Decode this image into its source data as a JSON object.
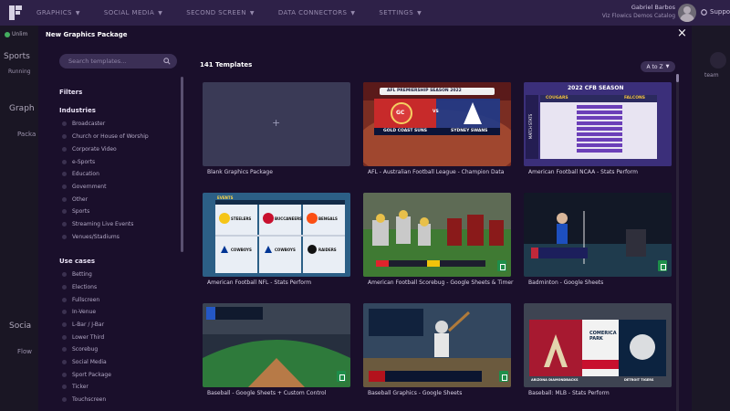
{
  "app": {
    "nav": [
      "GRAPHICS",
      "SOCIAL MEDIA",
      "SECOND SCREEN",
      "DATA CONNECTORS",
      "SETTINGS"
    ],
    "user": {
      "name": "Gabriel Barbos",
      "org": "Viz Flowics Demos Catalog"
    },
    "support_label": "Support",
    "bg": {
      "status": "Unlim",
      "sports": "Sports",
      "running": "Running",
      "graph": "Graph",
      "packa": "Packa",
      "socia": "Socia",
      "flow": "Flow",
      "team": "team"
    }
  },
  "modal": {
    "title": "New Graphics Package",
    "close": "×",
    "search_placeholder": "Search templates...",
    "filters_label": "Filters",
    "industries_label": "Industries",
    "industries": [
      "Broadcaster",
      "Church or House of Worship",
      "Corporate Video",
      "e-Sports",
      "Education",
      "Government",
      "Other",
      "Sports",
      "Streaming Live Events",
      "Venues/Stadiums"
    ],
    "use_cases_label": "Use cases",
    "use_cases": [
      "Betting",
      "Elections",
      "Fullscreen",
      "In-Venue",
      "L-Bar / J-Bar",
      "Lower Third",
      "Scorebug",
      "Social Media",
      "Sport Package",
      "Ticker",
      "Touchscreen"
    ],
    "template_count": "141 Templates",
    "sort_label": "A to Z",
    "templates": [
      {
        "label": "Blank Graphics Package",
        "blank": true,
        "plus": "+"
      },
      {
        "label": "AFL - Australian Football League - Champion Data",
        "banner": "AFL PREMIERSHIP SEASON 2022",
        "home": "GOLD COAST SUNS",
        "away": "SYDNEY SWANS",
        "home_abbr": "GC",
        "vs": "VS"
      },
      {
        "label": "American Football NCAA - Stats Perform",
        "banner": "2022 CFB SEASON",
        "home": "COUGARS",
        "away": "FALCONS",
        "side": "MATCH STATS"
      },
      {
        "label": "American Football NFL - Stats Perform",
        "events": "EVENTS",
        "teams": [
          "STEELERS",
          "BUCCANEERS",
          "BENGALS",
          "COWBOYS",
          "COWBOYS",
          "RAIDERS"
        ]
      },
      {
        "label": "American Football Scorebug - Google Sheets & Timer"
      },
      {
        "label": "Badminton - Google Sheets"
      },
      {
        "label": "Baseball - Google Sheets + Custom Control"
      },
      {
        "label": "Baseball Graphics - Google Sheets"
      },
      {
        "label": "Baseball: MLB - Stats Perform",
        "park": "COMERICA PARK",
        "home": "ARIZONA DIAMONDBACKS",
        "away": "DETROIT TIGERS"
      }
    ]
  }
}
